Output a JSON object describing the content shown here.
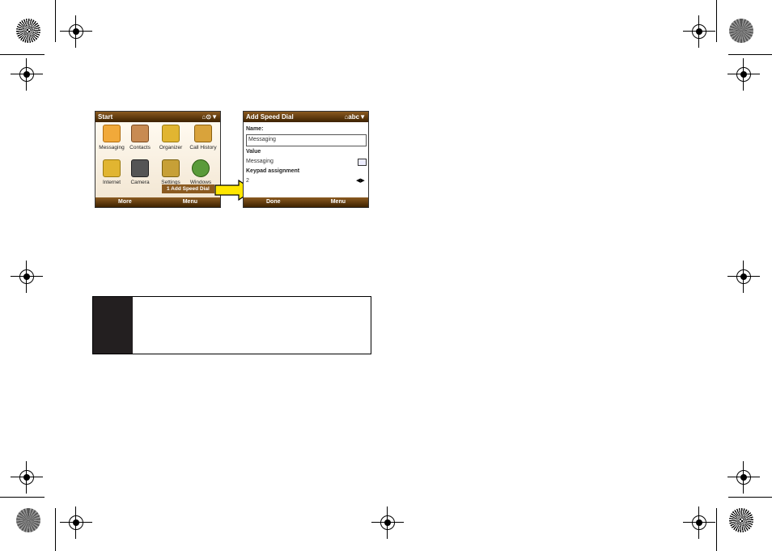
{
  "left_screen": {
    "title": "Start",
    "status_icons": "⌂⊙▼",
    "apps": [
      {
        "label": "Messaging",
        "icon": "envelope-icon",
        "color": "#f1a93a"
      },
      {
        "label": "Contacts",
        "icon": "contacts-icon",
        "color": "#c88b52"
      },
      {
        "label": "Organizer",
        "icon": "folder-icon",
        "color": "#e1b531"
      },
      {
        "label": "Call History",
        "icon": "call-history-icon",
        "color": "#d9a33b"
      },
      {
        "label": "Internet",
        "icon": "internet-folder-icon",
        "color": "#e1b531"
      },
      {
        "label": "Camera",
        "icon": "camera-icon",
        "color": "#555555"
      },
      {
        "label": "Settings",
        "icon": "settings-icon",
        "color": "#c7a037"
      },
      {
        "label": "Windows",
        "icon": "media-player-icon",
        "color": "#5a9b3a"
      }
    ],
    "popup_label": "1 Add Speed Dial",
    "soft_left": "More",
    "soft_right": "Menu"
  },
  "right_screen": {
    "title": "Add Speed Dial",
    "status_icons": "⌂abc▼",
    "name_label": "Name:",
    "name_value": "Messaging",
    "value_label": "Value",
    "value_text": "Messaging",
    "keypad_label": "Keypad assignment",
    "keypad_value": "2",
    "soft_left": "Done",
    "soft_right": "Menu"
  },
  "colors": {
    "bar": "#5a3410",
    "arrow": "#ffe600",
    "note_tab": "#231f20"
  }
}
